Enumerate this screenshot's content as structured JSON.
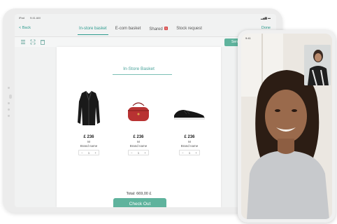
{
  "tablet": {
    "status_bar": {
      "carrier": "iPad",
      "time": "9:41 AM",
      "icons": "wifi-battery"
    },
    "nav": {
      "back_label": "< Back",
      "tabs": [
        {
          "label": "In-store basket",
          "active": true
        },
        {
          "label": "E-com basket",
          "active": false
        },
        {
          "label": "Shared",
          "active": false,
          "badge": "1"
        },
        {
          "label": "Stock request",
          "active": false
        }
      ],
      "done_label": "Done"
    },
    "toolbar": {
      "icons": [
        "list-icon",
        "scan-icon",
        "trash-icon"
      ],
      "send_label": "Send"
    },
    "basket": {
      "title": "In-Store Basket",
      "products": [
        {
          "image": "black-leather-jacket",
          "price": "£ 236",
          "size": "M",
          "brand": "Brand name",
          "quantity": "1",
          "minus": "−",
          "plus": "+"
        },
        {
          "image": "red-handbag",
          "price": "£ 236",
          "size": "M",
          "brand": "Brand name",
          "quantity": "1",
          "minus": "−",
          "plus": "+"
        },
        {
          "image": "black-sneaker",
          "price": "£ 236",
          "size": "M",
          "brand": "Brand name",
          "quantity": "1",
          "minus": "−",
          "plus": "+"
        }
      ],
      "total": "Total: 669,00 £",
      "checkout_label": "Check Out"
    }
  },
  "phone": {
    "status_time": "9:41",
    "video_call": {
      "main_feed": "customer-video",
      "pip_feed": "sales-associate-video"
    }
  },
  "colors": {
    "accent": "#5fb39d",
    "accent_text": "#2e9c8f",
    "badge": "#d64545"
  }
}
